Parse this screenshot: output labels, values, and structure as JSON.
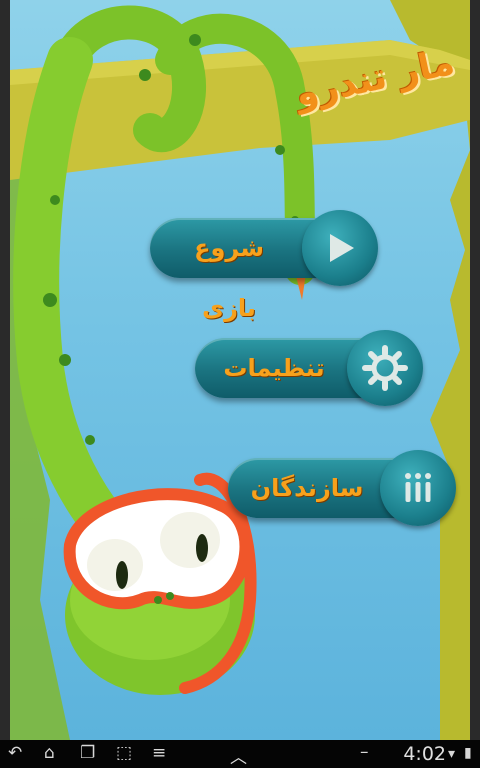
{
  "game": {
    "title": "مار تندرو",
    "menu": [
      {
        "label": "شروع بازی",
        "icon": "play-icon"
      },
      {
        "label": "تنظیمات",
        "icon": "gear-icon"
      },
      {
        "label": "سازندگان",
        "icon": "bars-icon"
      }
    ]
  },
  "status_bar": {
    "time": "4:02",
    "nav_icons": [
      "back-icon",
      "home-icon",
      "recent-apps-icon",
      "screenshot-icon",
      "menu-icon",
      "up-chevron-icon"
    ],
    "status_icons": [
      "minus-icon",
      "wifi-icon",
      "battery-icon"
    ]
  },
  "colors": {
    "sky": "#74c3e4",
    "branch": "#c9c23a",
    "snake": "#8ccc2e",
    "button": "#1a7380",
    "label_orange": "#f7a11c",
    "mask": "#f0562a"
  }
}
